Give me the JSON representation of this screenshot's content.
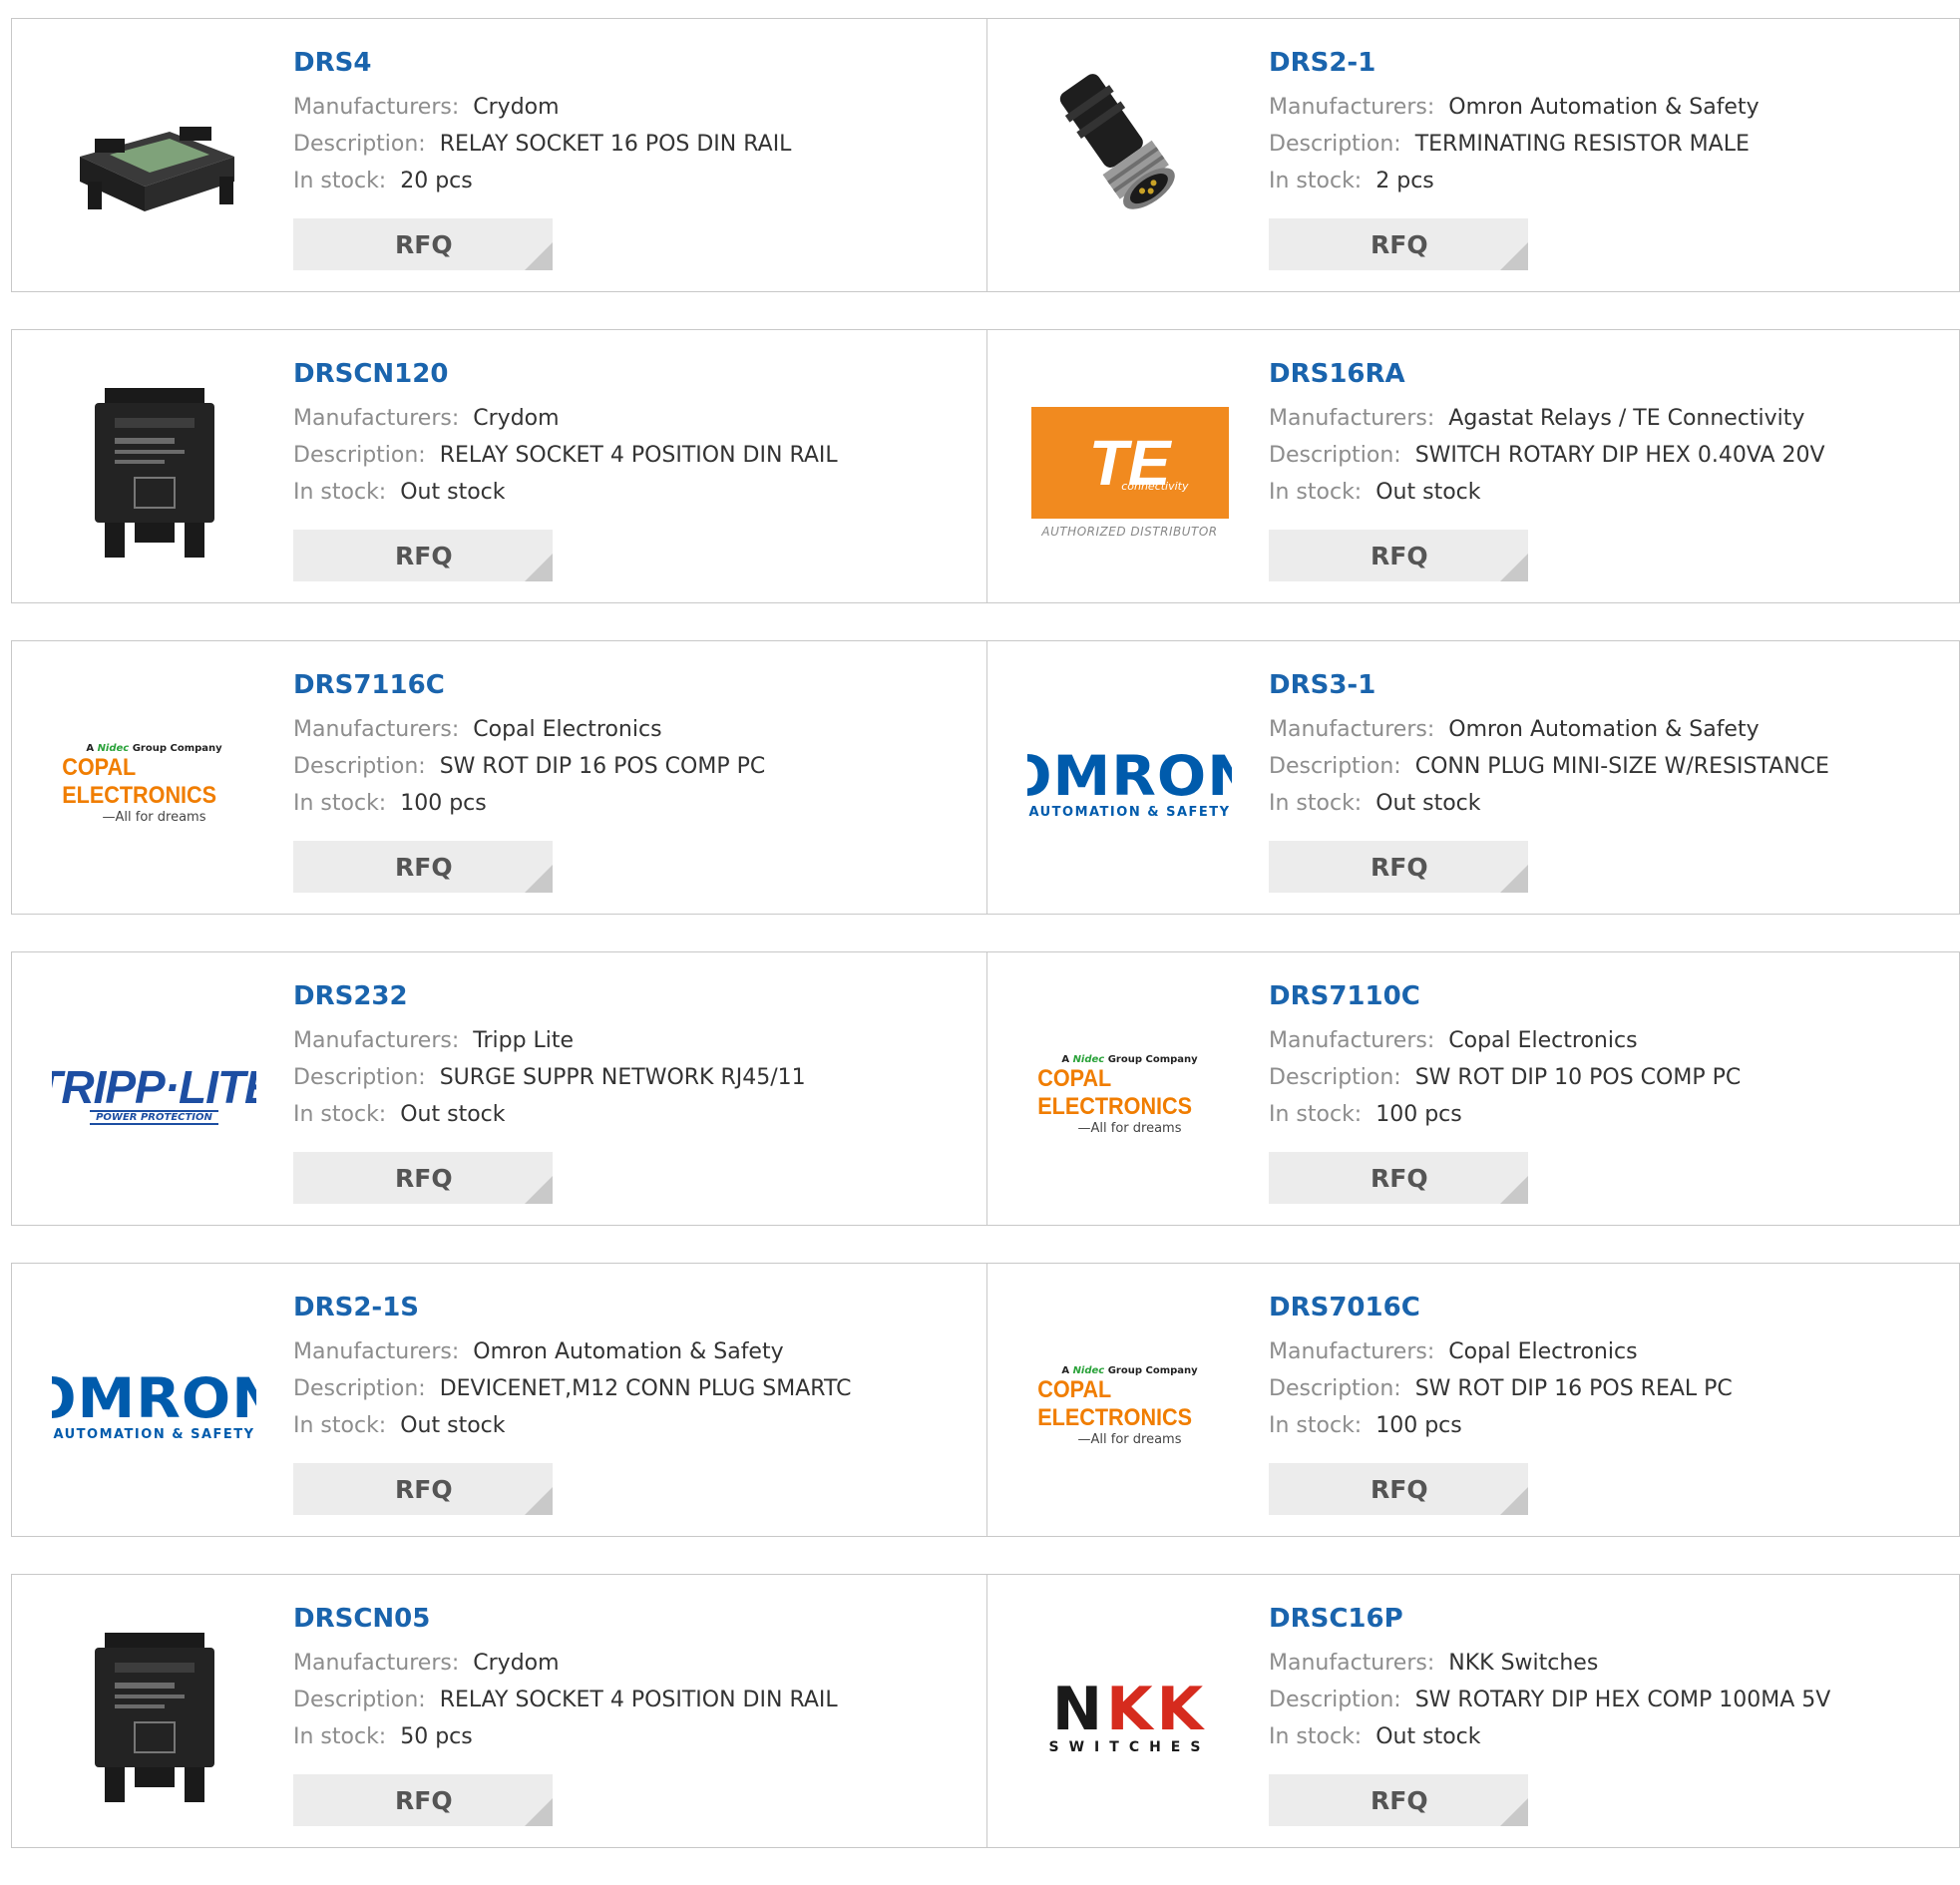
{
  "labels": {
    "manufacturers": "Manufacturers:",
    "description": "Description:",
    "in_stock": "In stock:",
    "rfq": "RFQ"
  },
  "colors": {
    "part_link": "#1a64ad",
    "label_gray": "#8d8d8d",
    "rfq_bg": "#ececec"
  },
  "products": [
    {
      "part": "DRS4",
      "manufacturer": "Crydom",
      "description": "RELAY SOCKET 16 POS DIN RAIL",
      "stock": "20 pcs",
      "image": "din-rail-socket-photo"
    },
    {
      "part": "DRS2-1",
      "manufacturer": "Omron Automation & Safety",
      "description": "TERMINATING RESISTOR MALE",
      "stock": "2 pcs",
      "image": "m12-connector-photo"
    },
    {
      "part": "DRSCN120",
      "manufacturer": "Crydom",
      "description": "RELAY SOCKET 4 POSITION DIN RAIL",
      "stock": "Out stock",
      "image": "crydom-relay-socket-photo"
    },
    {
      "part": "DRS16RA",
      "manufacturer": "Agastat Relays / TE Connectivity",
      "description": "SWITCH ROTARY DIP HEX 0.40VA 20V",
      "stock": "Out stock",
      "image": "te-connectivity-logo"
    },
    {
      "part": "DRS7116C",
      "manufacturer": "Copal Electronics",
      "description": "SW ROT DIP 16 POS COMP PC",
      "stock": "100 pcs",
      "image": "copal-electronics-logo"
    },
    {
      "part": "DRS3-1",
      "manufacturer": "Omron Automation & Safety",
      "description": "CONN PLUG MINI-SIZE W/RESISTANCE",
      "stock": "Out stock",
      "image": "omron-logo"
    },
    {
      "part": "DRS232",
      "manufacturer": "Tripp Lite",
      "description": "SURGE SUPPR NETWORK RJ45/11",
      "stock": "Out stock",
      "image": "tripp-lite-logo"
    },
    {
      "part": "DRS7110C",
      "manufacturer": "Copal Electronics",
      "description": "SW ROT DIP 10 POS COMP PC",
      "stock": "100 pcs",
      "image": "copal-electronics-logo"
    },
    {
      "part": "DRS2-1S",
      "manufacturer": "Omron Automation & Safety",
      "description": "DEVICENET,M12 CONN PLUG SMARTC",
      "stock": "Out stock",
      "image": "omron-logo"
    },
    {
      "part": "DRS7016C",
      "manufacturer": "Copal Electronics",
      "description": "SW ROT DIP 16 POS REAL PC",
      "stock": "100 pcs",
      "image": "copal-electronics-logo"
    },
    {
      "part": "DRSCN05",
      "manufacturer": "Crydom",
      "description": "RELAY SOCKET 4 POSITION DIN RAIL",
      "stock": "50 pcs",
      "image": "crydom-relay-socket-photo"
    },
    {
      "part": "DRSC16P",
      "manufacturer": "NKK Switches",
      "description": "SW ROTARY DIP HEX COMP 100MA 5V",
      "stock": "Out stock",
      "image": "nkk-switches-logo"
    }
  ],
  "logos": {
    "omron": {
      "word": "OMRON",
      "sub": "AUTOMATION & SAFETY"
    },
    "copal": {
      "top_a": "A",
      "top_nidec": "Nidec",
      "top_rest": "Group Company",
      "main": "COPAL ELECTRONICS",
      "tag": "—All for dreams"
    },
    "te": {
      "word": "TE",
      "conn": "connectivity",
      "auth": "AUTHORIZED DISTRIBUTOR"
    },
    "tripp": {
      "word": "TRIPP·LITE",
      "sub": "POWER PROTECTION"
    },
    "nkk": {
      "word_n": "N",
      "word_kk": "KK",
      "sub": "SWITCHES"
    }
  }
}
